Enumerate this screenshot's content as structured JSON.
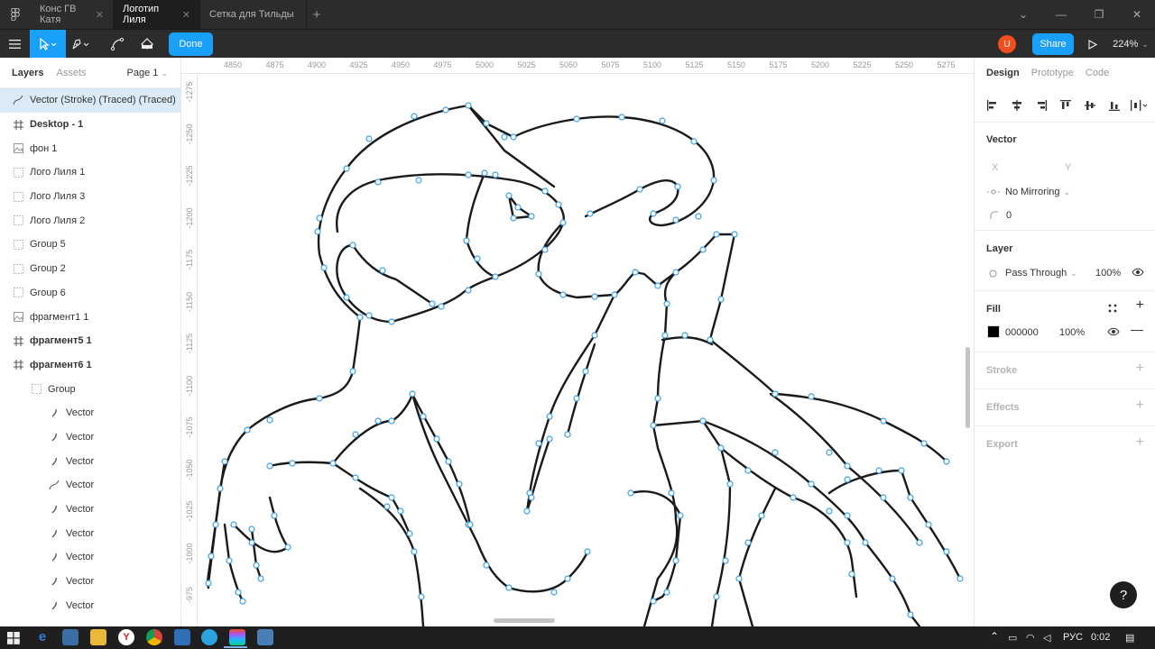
{
  "tabs": [
    {
      "label": "Конс ГВ Катя"
    },
    {
      "label": "Логотип Лиля"
    },
    {
      "label": "Сетка для Тильды"
    }
  ],
  "toolbar": {
    "done_label": "Done",
    "share_label": "Share",
    "zoom": "224%",
    "avatar_letter": "U"
  },
  "left_panel": {
    "tab_layers": "Layers",
    "tab_assets": "Assets",
    "page": "Page 1",
    "layers": [
      {
        "label": "Vector (Stroke) (Traced) (Traced)",
        "icon": "vector-pen-icon"
      },
      {
        "label": "Desktop - 1",
        "icon": "frame-icon"
      },
      {
        "label": "фон 1",
        "icon": "image-icon"
      },
      {
        "label": "Лого Лиля 1",
        "icon": "group-icon"
      },
      {
        "label": "Лого Лиля 3",
        "icon": "group-icon"
      },
      {
        "label": "Лого Лиля 2",
        "icon": "group-icon"
      },
      {
        "label": "Group 5",
        "icon": "group-icon"
      },
      {
        "label": "Group 2",
        "icon": "group-icon"
      },
      {
        "label": "Group 6",
        "icon": "group-icon"
      },
      {
        "label": "фрагмент1 1",
        "icon": "image-icon"
      },
      {
        "label": "фрагмент5 1",
        "icon": "frame-icon"
      },
      {
        "label": "фрагмент6 1",
        "icon": "frame-icon"
      },
      {
        "label": "Group",
        "icon": "group-icon"
      },
      {
        "label": "Vector",
        "icon": "vector-icon"
      },
      {
        "label": "Vector",
        "icon": "vector-icon"
      },
      {
        "label": "Vector",
        "icon": "vector-icon"
      },
      {
        "label": "Vector",
        "icon": "vector-pen-icon"
      },
      {
        "label": "Vector",
        "icon": "vector-icon"
      },
      {
        "label": "Vector",
        "icon": "vector-icon"
      },
      {
        "label": "Vector",
        "icon": "vector-icon"
      },
      {
        "label": "Vector",
        "icon": "vector-icon"
      },
      {
        "label": "Vector",
        "icon": "vector-icon"
      }
    ]
  },
  "rulers": {
    "top": [
      "4850",
      "4875",
      "4900",
      "4925",
      "4950",
      "4975",
      "5000",
      "5025",
      "5050",
      "5075",
      "5100",
      "5125",
      "5150",
      "5175",
      "5200",
      "5225",
      "5250",
      "5275"
    ],
    "left": [
      "-1275",
      "-1250",
      "-1225",
      "-1200",
      "-1175",
      "-1150",
      "-1125",
      "-1100",
      "-1075",
      "-1050",
      "-1025",
      "-1000",
      "-975"
    ]
  },
  "right_panel": {
    "tab_design": "Design",
    "tab_prototype": "Prototype",
    "tab_code": "Code",
    "vector_title": "Vector",
    "x_label": "X",
    "y_label": "Y",
    "mirroring": "No Mirroring",
    "corner_radius": "0",
    "layer_title": "Layer",
    "blend_mode": "Pass Through",
    "layer_opacity": "100%",
    "fill_title": "Fill",
    "fill_hex": "000000",
    "fill_opacity": "100%",
    "fill_color": "#000000",
    "stroke_title": "Stroke",
    "effects_title": "Effects",
    "export_title": "Export"
  },
  "taskbar": {
    "lang": "РУС",
    "time": "0:02"
  },
  "help_label": "?"
}
